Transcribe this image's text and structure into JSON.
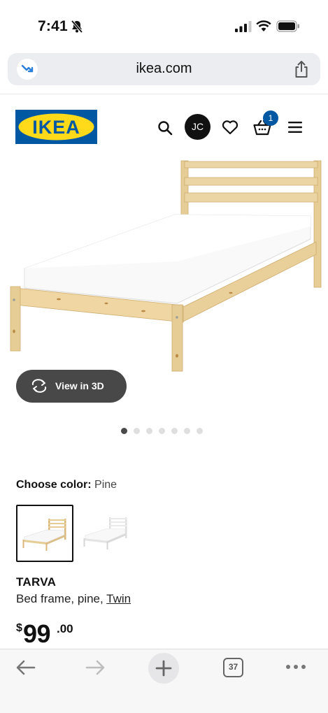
{
  "status_bar": {
    "time": "7:41"
  },
  "url_bar": {
    "domain": "ikea.com"
  },
  "header": {
    "logo_text": "IKEA",
    "avatar_initials": "JC",
    "cart_count": "1"
  },
  "gallery": {
    "view_3d_label": "View in 3D",
    "image_count": 7,
    "active_index": 0
  },
  "color": {
    "label": "Choose color:",
    "selected": "Pine"
  },
  "product": {
    "name": "TARVA",
    "description": "Bed frame, pine, ",
    "size": "Twin",
    "price_currency": "$",
    "price_whole": "99",
    "price_decimal": ".00"
  },
  "toolbar": {
    "tab_count": "37"
  },
  "colors": {
    "ikea_blue": "#0058a3",
    "ikea_yellow": "#ffda1a",
    "pine": "#e9cf9a",
    "button_dark": "#484848"
  }
}
